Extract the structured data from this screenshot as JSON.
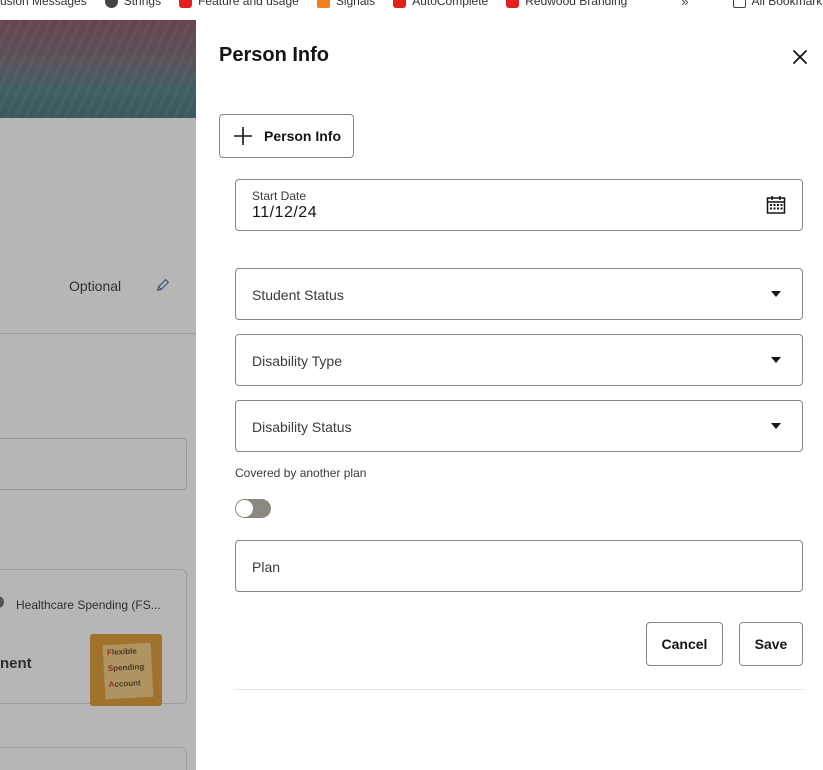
{
  "bookmarks": {
    "items": [
      {
        "label": "usion Messages",
        "icon": "globe-icon"
      },
      {
        "label": "Strings",
        "icon": "globe-icon"
      },
      {
        "label": "Feature and usage",
        "icon": "oracle-icon"
      },
      {
        "label": "Signals",
        "icon": "signal-icon"
      },
      {
        "label": "AutoComplete",
        "icon": "oracle-icon"
      },
      {
        "label": "Redwood Branding",
        "icon": "oracle-icon"
      }
    ],
    "more": "»",
    "all_bookmarks": "All Bookmarks"
  },
  "background": {
    "optional_label": "Optional",
    "card_text": "Healthcare Spending (FS...",
    "card_title": "nent",
    "card_image_lines": [
      "Flexible",
      "Spending",
      "Account"
    ]
  },
  "drawer": {
    "title": "Person Info",
    "add_button_label": "Person Info",
    "start_date": {
      "label": "Start Date",
      "value": "11/12/24"
    },
    "student_status": {
      "label": "Student Status"
    },
    "disability_type": {
      "label": "Disability Type"
    },
    "disability_status": {
      "label": "Disability Status"
    },
    "covered_label": "Covered by another plan",
    "covered_value": false,
    "plan": {
      "label": "Plan"
    },
    "cancel_label": "Cancel",
    "save_label": "Save"
  }
}
